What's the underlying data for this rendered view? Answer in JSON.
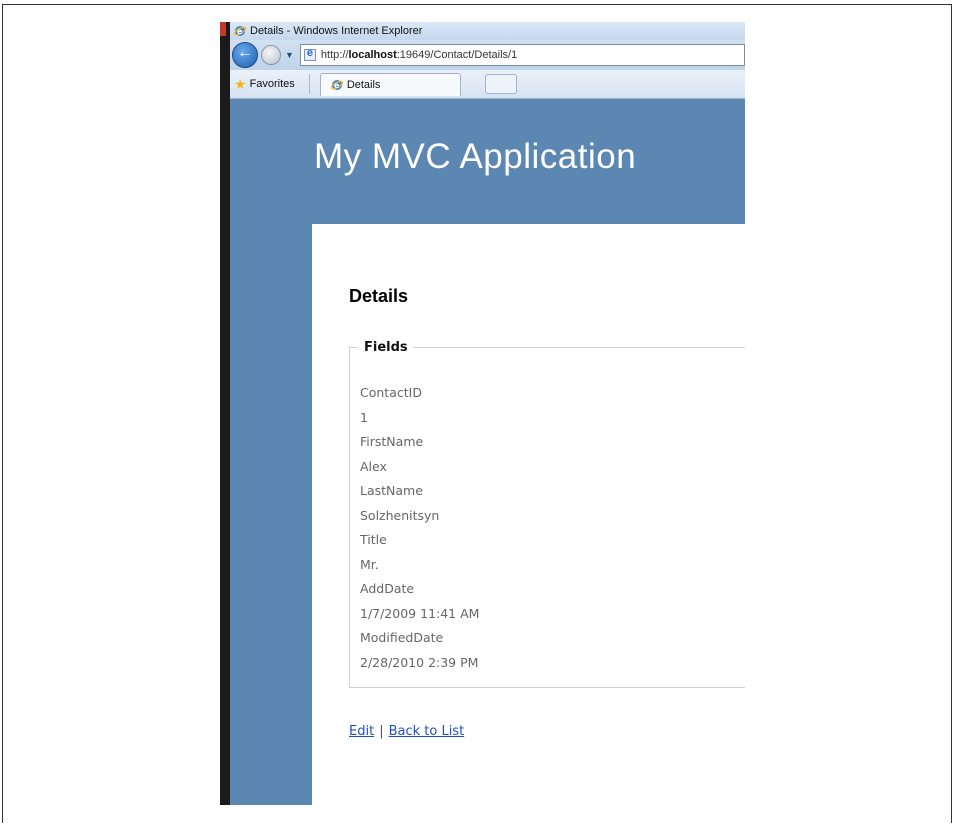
{
  "browser": {
    "window_title": "Details - Windows Internet Explorer",
    "address": {
      "prefix": "http://",
      "host": "localhost",
      "rest": ":19649/Contact/Details/1"
    },
    "favorites_label": "Favorites",
    "tab_label": "Details"
  },
  "site": {
    "header_title": "My MVC Application"
  },
  "content": {
    "page_heading": "Details",
    "legend": "Fields",
    "fields": [
      "ContactID",
      "1",
      "FirstName",
      "Alex",
      "LastName",
      "Solzhenitsyn",
      "Title",
      "Mr.",
      "AddDate",
      "1/7/2009 11:41 AM",
      "ModifiedDate",
      "2/28/2010 2:39 PM"
    ],
    "links": {
      "edit": "Edit",
      "separator": "|",
      "back": "Back to List"
    }
  },
  "colors": {
    "site_header_bg": "#5c87b2",
    "link": "#1f4fc7"
  },
  "icons": [
    "ie-icon",
    "back-arrow-icon",
    "forward-arrow-icon",
    "page-icon",
    "favorites-star-icon"
  ]
}
